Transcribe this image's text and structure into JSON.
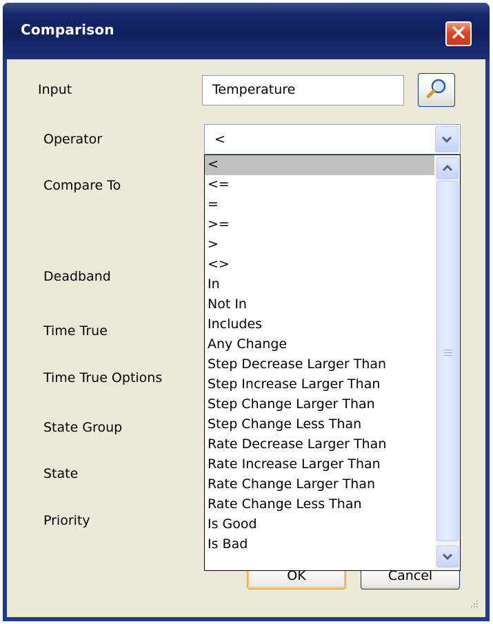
{
  "window": {
    "title": "Comparison",
    "accent": "#0a246a",
    "close_button_color": "#e2461e"
  },
  "form": {
    "input_label": "Input",
    "input_value": "Temperature",
    "operator_label": "Operator",
    "operator_value": "<",
    "compare_to_label": "Compare To",
    "deadband_label": "Deadband",
    "time_true_label": "Time True",
    "time_true_options_label": "Time True Options",
    "state_group_label": "State Group",
    "state_label": "State",
    "priority_label": "Priority"
  },
  "buttons": {
    "ok_label": "OK",
    "cancel_label": "Cancel"
  },
  "dropdown": {
    "selected": "<",
    "options": [
      "<",
      "<=",
      "=",
      ">=",
      ">",
      "<>",
      "In",
      "Not In",
      "Includes",
      "Any Change",
      "Step Decrease Larger Than",
      "Step Increase Larger Than",
      "Step Change Larger Than",
      "Step Change Less Than",
      "Rate Decrease Larger Than",
      "Rate Increase Larger Than",
      "Rate Change Larger Than",
      "Rate Change Less Than",
      "Is Good",
      "Is Bad"
    ]
  },
  "icons": {
    "lookup": "magnifier-icon",
    "close": "close-icon",
    "combo_arrow": "chevron-down-icon",
    "scroll_up": "chevron-up-icon",
    "scroll_down": "chevron-down-icon",
    "size_grip": "resize-grip-icon"
  }
}
